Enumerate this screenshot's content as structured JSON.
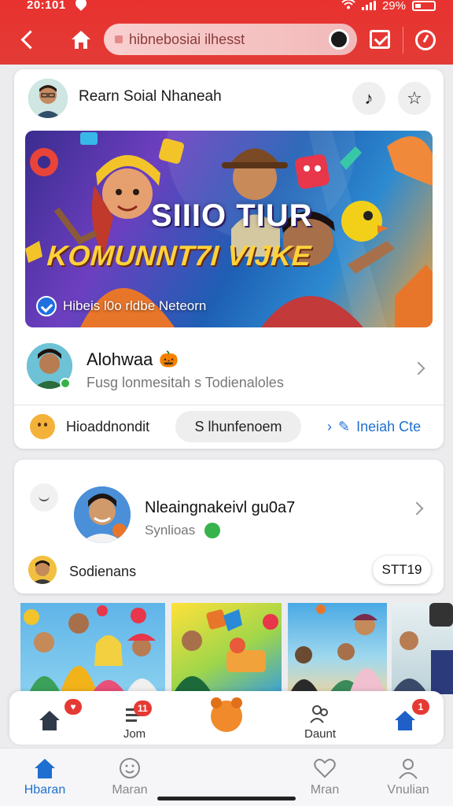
{
  "status_bar": {
    "time": "20:101",
    "battery": "29%"
  },
  "app_bar": {
    "search_value": "hibnebosiai ilhesst",
    "icons": [
      "back-icon",
      "home-icon",
      "camera-icon",
      "inbox-icon",
      "clock-icon"
    ]
  },
  "post": {
    "page_name": "Rearn Soial Nhaneah",
    "banner": {
      "title": "SIIIO TIUR",
      "subtitle": "KOMUNNT7I VIJKE",
      "caption": "Hibeis l0o rldbe Neteorn"
    },
    "user": {
      "name": "Alohwaa",
      "emoji": "🎃",
      "subtitle": "Fusg lonmesitah s Todienaloles"
    },
    "actions": {
      "left_label": "Hioaddnondit",
      "pill_button": "S lhunfenoem",
      "link_label": "Ineiah Cte"
    }
  },
  "suggestion": {
    "name": "Nleaingnakeivl gu0a7",
    "subtitle": "Synlioas",
    "footer_label": "Sodienans",
    "button": "STT19"
  },
  "float_bar": {
    "items": [
      {
        "label": "",
        "badge": "♥"
      },
      {
        "label": "Jom",
        "badge": "11"
      },
      {
        "label": "",
        "badge": ""
      },
      {
        "label": "Daunt",
        "badge": ""
      },
      {
        "label": "",
        "badge": "1"
      }
    ]
  },
  "bottom_nav": {
    "items": [
      {
        "label": "Hbaran",
        "active": true
      },
      {
        "label": "Maran",
        "active": false
      },
      {
        "label": "Mran",
        "active": false
      },
      {
        "label": "Vnulian",
        "active": false
      }
    ]
  },
  "colors": {
    "brand_red": "#e8322f",
    "accent_blue": "#1e6fd0",
    "banner_yellow": "#ffd23a"
  }
}
